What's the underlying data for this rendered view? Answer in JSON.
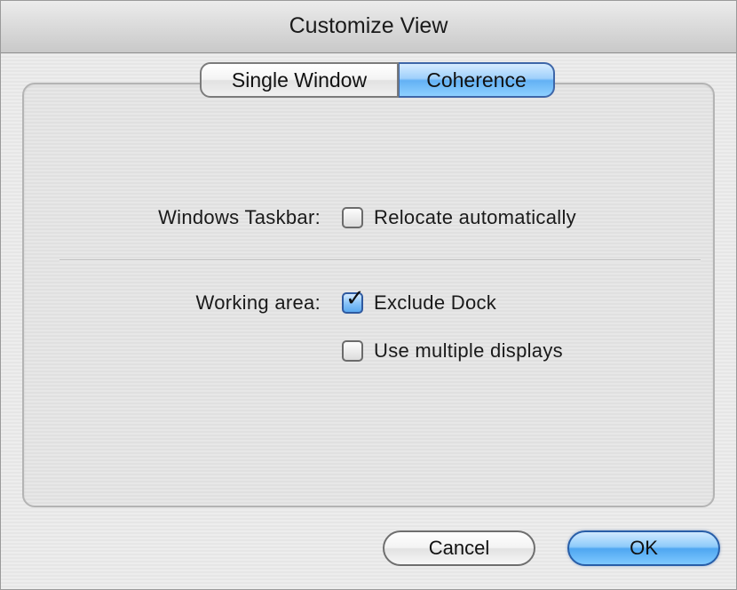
{
  "window": {
    "title": "Customize View"
  },
  "tabs": [
    {
      "label": "Single Window",
      "selected": false
    },
    {
      "label": "Coherence",
      "selected": true
    }
  ],
  "taskbar": {
    "label": "Windows Taskbar:",
    "options": [
      {
        "label": "Relocate automatically",
        "checked": false
      }
    ]
  },
  "working_area": {
    "label": "Working area:",
    "options": [
      {
        "label": "Exclude Dock",
        "checked": true
      },
      {
        "label": "Use multiple displays",
        "checked": false
      }
    ]
  },
  "buttons": {
    "cancel": "Cancel",
    "ok": "OK"
  },
  "colors": {
    "accent": "#63b1f4",
    "panel_border": "#b4b4b4"
  }
}
